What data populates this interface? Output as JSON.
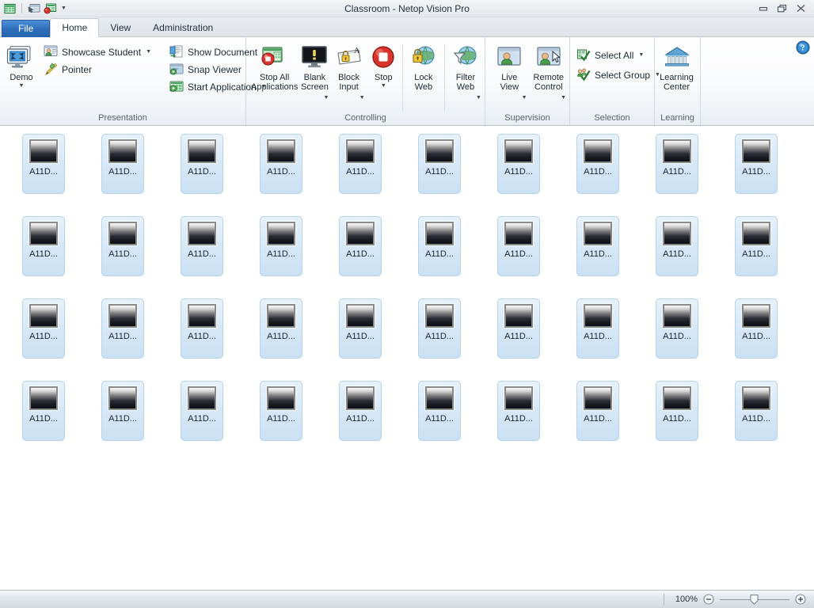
{
  "window": {
    "title": "Classroom - Netop Vision Pro",
    "quick_access": [
      {
        "name": "grid-icon",
        "label": "Classroom View"
      },
      {
        "name": "pointer-board-icon",
        "label": "Pointer"
      },
      {
        "name": "stop-board-icon",
        "label": "Stop"
      },
      {
        "name": "chevron-down-icon",
        "label": "Customize Quick Access Toolbar"
      }
    ],
    "controls": [
      {
        "name": "minimize-button",
        "label": "Minimize"
      },
      {
        "name": "restore-button",
        "label": "Restore"
      },
      {
        "name": "close-button",
        "label": "Close"
      }
    ]
  },
  "tabs": [
    {
      "label": "File",
      "type": "file",
      "active": false
    },
    {
      "label": "Home",
      "type": "normal",
      "active": true
    },
    {
      "label": "View",
      "type": "normal",
      "active": false
    },
    {
      "label": "Administration",
      "type": "normal",
      "active": false
    }
  ],
  "ribbon": {
    "help_label": "Help",
    "groups": [
      {
        "label": "Presentation",
        "big": {
          "label": "Demo",
          "caret": true,
          "icon": "demo-monitors-icon"
        },
        "small_sets": [
          [
            {
              "label": "Showcase Student",
              "caret": true,
              "icon": "showcase-student-icon"
            },
            {
              "label": "Pointer",
              "caret": false,
              "icon": "pointer-pencil-icon"
            }
          ],
          [
            {
              "label": "Show Document",
              "caret": false,
              "icon": "show-document-icon"
            },
            {
              "label": "Snap Viewer",
              "caret": false,
              "icon": "snap-viewer-icon"
            },
            {
              "label": "Start Application",
              "caret": true,
              "icon": "start-application-icon"
            }
          ]
        ]
      },
      {
        "label": "Controlling",
        "buttons": [
          {
            "label": "Stop All\nApplications",
            "caret": false,
            "icon": "stop-all-applications-icon",
            "width": "wide"
          },
          {
            "label": "Blank\nScreen",
            "caret": true,
            "icon": "blank-screen-icon"
          },
          {
            "label": "Block\nInput",
            "caret": true,
            "icon": "block-input-icon"
          },
          {
            "label": "Stop",
            "caret": true,
            "icon": "stop-icon",
            "narrow": true
          },
          {
            "label": "Lock\nWeb",
            "caret": false,
            "icon": "lock-web-icon",
            "divider_before": true
          },
          {
            "label": "Filter\nWeb",
            "caret": true,
            "icon": "filter-web-icon",
            "divider_before": true
          }
        ]
      },
      {
        "label": "Supervision",
        "buttons": [
          {
            "label": "Live\nView",
            "caret": true,
            "icon": "live-view-icon"
          },
          {
            "label": "Remote\nControl",
            "caret": true,
            "icon": "remote-control-icon"
          }
        ]
      },
      {
        "label": "Selection",
        "small_sets": [
          [
            {
              "label": "Select All",
              "caret": true,
              "icon": "select-all-icon"
            },
            {
              "label": "Select Group",
              "caret": true,
              "icon": "select-group-icon"
            }
          ]
        ]
      },
      {
        "label": "Learning",
        "big": {
          "label": "Learning\nCenter",
          "caret": false,
          "icon": "learning-center-icon"
        }
      }
    ]
  },
  "workspace": {
    "columns": 10,
    "rows": 4,
    "student_label": "A11D...",
    "students": [
      [
        "A11D...",
        "A11D...",
        "A11D...",
        "A11D...",
        "A11D...",
        "A11D...",
        "A11D...",
        "A11D...",
        "A11D...",
        "A11D..."
      ],
      [
        "A11D...",
        "A11D...",
        "A11D...",
        "A11D...",
        "A11D...",
        "A11D...",
        "A11D...",
        "A11D...",
        "A11D...",
        "A11D..."
      ],
      [
        "A11D...",
        "A11D...",
        "A11D...",
        "A11D...",
        "A11D...",
        "A11D...",
        "A11D...",
        "A11D...",
        "A11D...",
        "A11D..."
      ],
      [
        "A11D...",
        "A11D...",
        "A11D...",
        "A11D...",
        "A11D...",
        "A11D...",
        "A11D...",
        "A11D...",
        "A11D...",
        "A11D..."
      ]
    ]
  },
  "statusbar": {
    "message": "",
    "zoom": {
      "percent": "100%",
      "zoom_out_label": "Zoom Out",
      "zoom_in_label": "Zoom In",
      "slider_label": "Zoom slider"
    }
  },
  "colors": {
    "file_tab": "#2f70bd",
    "tile_fill": "#d5e7f7",
    "tile_border": "#b6d3ea",
    "ribbon_bg": "#f4f7fa",
    "help_blue": "#1f6fb5"
  }
}
